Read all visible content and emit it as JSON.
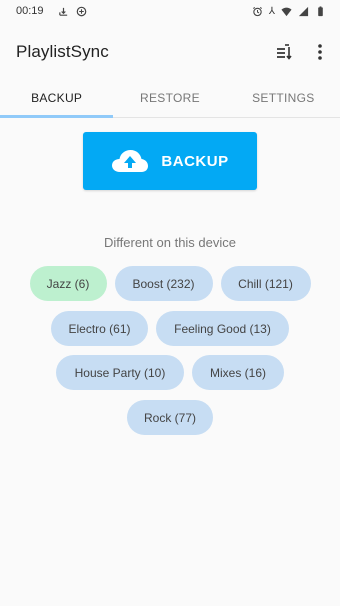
{
  "status_bar": {
    "time": "00:19",
    "right_text": "⅄"
  },
  "app": {
    "title": "PlaylistSync"
  },
  "tabs": [
    {
      "label": "BACKUP",
      "active": true
    },
    {
      "label": "RESTORE",
      "active": false
    },
    {
      "label": "SETTINGS",
      "active": false
    }
  ],
  "backup": {
    "label": "BACKUP",
    "color": "#03a9f4"
  },
  "section": {
    "label": "Different on this device"
  },
  "chips": [
    {
      "label": "Jazz (6)",
      "color": "#bdf0cf"
    },
    {
      "label": "Boost (232)",
      "color": "#c7ddf3"
    },
    {
      "label": "Chill (121)",
      "color": "#c7ddf3"
    },
    {
      "label": "Electro (61)",
      "color": "#c7ddf3"
    },
    {
      "label": "Feeling Good (13)",
      "color": "#c7ddf3"
    },
    {
      "label": "House Party (10)",
      "color": "#c7ddf3"
    },
    {
      "label": "Mixes (16)",
      "color": "#c7ddf3"
    },
    {
      "label": "Rock (77)",
      "color": "#c7ddf3"
    }
  ]
}
